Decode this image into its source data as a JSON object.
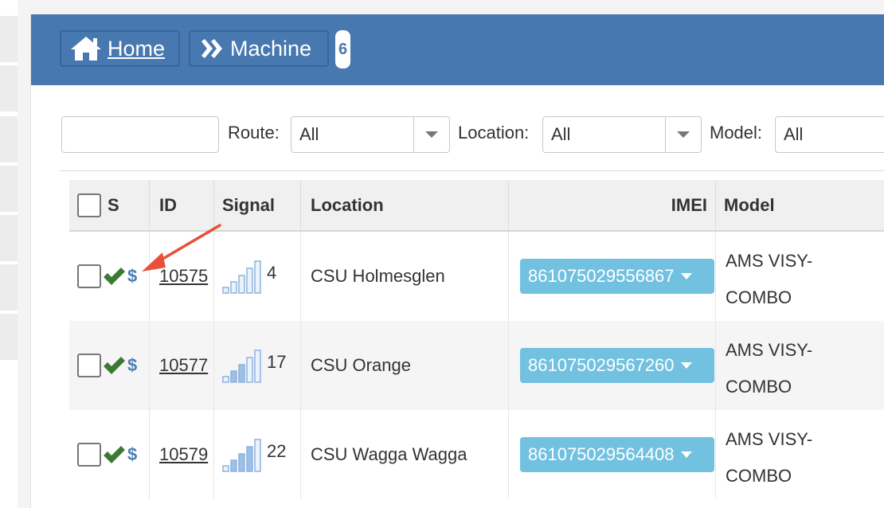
{
  "header": {
    "home_label": "Home",
    "machine_label": "Machine",
    "badge_count": "6"
  },
  "filters": {
    "search_value": "",
    "route_label": "Route:",
    "route_value": "All",
    "location_label": "Location:",
    "location_value": "All",
    "model_label": "Model:",
    "model_value": "All"
  },
  "table": {
    "columns": [
      "S",
      "ID",
      "Signal",
      "Location",
      "IMEI",
      "Model"
    ],
    "rows": [
      {
        "id": "10575",
        "signal": "4",
        "location": "CSU Holmesglen",
        "imei": "861075029556867",
        "model": "AMS VISY-COMBO"
      },
      {
        "id": "10577",
        "signal": "17",
        "location": "CSU Orange",
        "imei": "861075029567260",
        "model": "AMS VISY-COMBO"
      },
      {
        "id": "10579",
        "signal": "22",
        "location": "CSU Wagga Wagga",
        "imei": "861075029564408",
        "model": "AMS VISY-COMBO"
      }
    ]
  },
  "icons": {
    "check_color": "#3c7a34",
    "dollar_color": "#4a7fb5",
    "annotation_arrow_color": "#e8503a"
  }
}
